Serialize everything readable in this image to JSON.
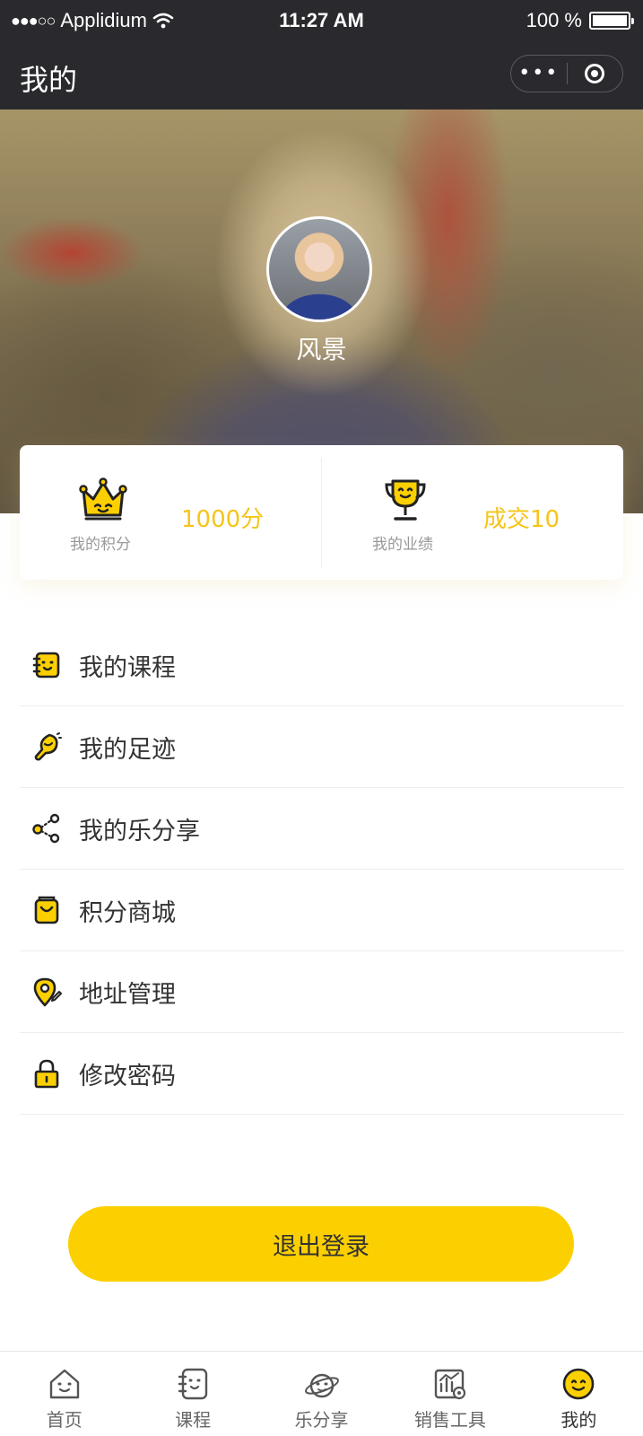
{
  "status_bar": {
    "signal": "●●●○○",
    "carrier": "Applidium",
    "time": "11:27 AM",
    "battery": "100 %"
  },
  "nav": {
    "title": "我的"
  },
  "profile": {
    "name": "风景"
  },
  "stats": [
    {
      "label": "我的积分",
      "value": "1000分",
      "icon": "crown-icon"
    },
    {
      "label": "我的业绩",
      "value": "成交10",
      "icon": "trophy-icon"
    }
  ],
  "menu": [
    {
      "label": "我的课程",
      "icon": "course-notebook-icon"
    },
    {
      "label": "我的足迹",
      "icon": "footprint-icon"
    },
    {
      "label": "我的乐分享",
      "icon": "share-icon"
    },
    {
      "label": "积分商城",
      "icon": "shopping-bag-icon"
    },
    {
      "label": "地址管理",
      "icon": "location-pin-icon"
    },
    {
      "label": "修改密码",
      "icon": "lock-icon"
    }
  ],
  "logout_label": "退出登录",
  "tabs": [
    {
      "label": "首页",
      "icon": "home-icon",
      "active": false
    },
    {
      "label": "课程",
      "icon": "course-icon",
      "active": false
    },
    {
      "label": "乐分享",
      "icon": "planet-share-icon",
      "active": false
    },
    {
      "label": "销售工具",
      "icon": "sales-tools-icon",
      "active": false
    },
    {
      "label": "我的",
      "icon": "smiley-face-icon",
      "active": true
    }
  ],
  "colors": {
    "accent": "#fcd000",
    "stat_value": "#f5c518",
    "bar_dark": "#2a2a2e"
  }
}
